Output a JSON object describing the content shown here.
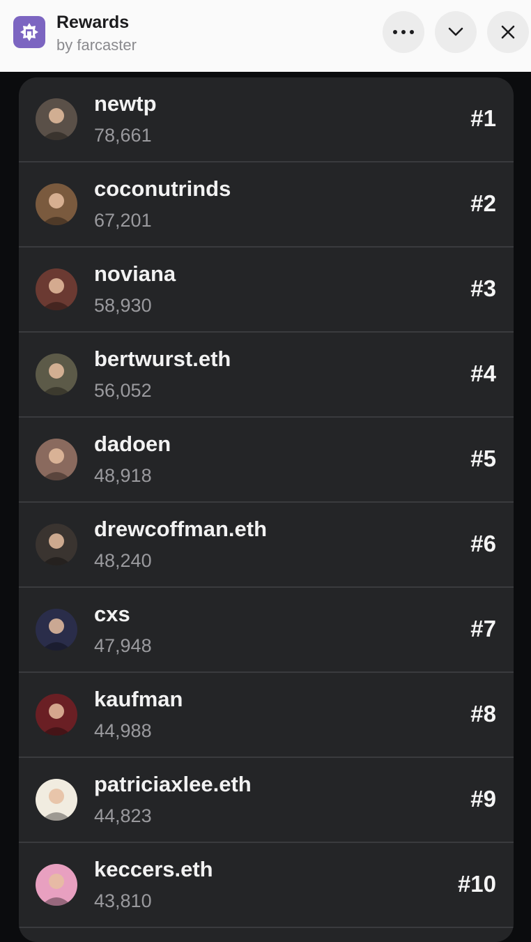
{
  "header": {
    "title": "Rewards",
    "subtitle": "by farcaster",
    "icons": [
      "farcaster-app-icon",
      "more-icon",
      "chevron-down-icon",
      "close-icon"
    ],
    "accent": "#7c65c1"
  },
  "leaderboard": [
    {
      "name": "newtp",
      "score": "78,661",
      "rank": "#1",
      "avatar_color": "#5a5048"
    },
    {
      "name": "coconutrinds",
      "score": "67,201",
      "rank": "#2",
      "avatar_color": "#7a5a3e"
    },
    {
      "name": "noviana",
      "score": "58,930",
      "rank": "#3",
      "avatar_color": "#6b3a32"
    },
    {
      "name": "bertwurst.eth",
      "score": "56,052",
      "rank": "#4",
      "avatar_color": "#5c5a48"
    },
    {
      "name": "dadoen",
      "score": "48,918",
      "rank": "#5",
      "avatar_color": "#8a6a5e"
    },
    {
      "name": "drewcoffman.eth",
      "score": "48,240",
      "rank": "#6",
      "avatar_color": "#3a3430"
    },
    {
      "name": "cxs",
      "score": "47,948",
      "rank": "#7",
      "avatar_color": "#2a2d4a"
    },
    {
      "name": "kaufman",
      "score": "44,988",
      "rank": "#8",
      "avatar_color": "#6a1f24"
    },
    {
      "name": "patriciaxlee.eth",
      "score": "44,823",
      "rank": "#9",
      "avatar_color": "#f1ece0"
    },
    {
      "name": "keccers.eth",
      "score": "43,810",
      "rank": "#10",
      "avatar_color": "#e8a0c0"
    }
  ]
}
